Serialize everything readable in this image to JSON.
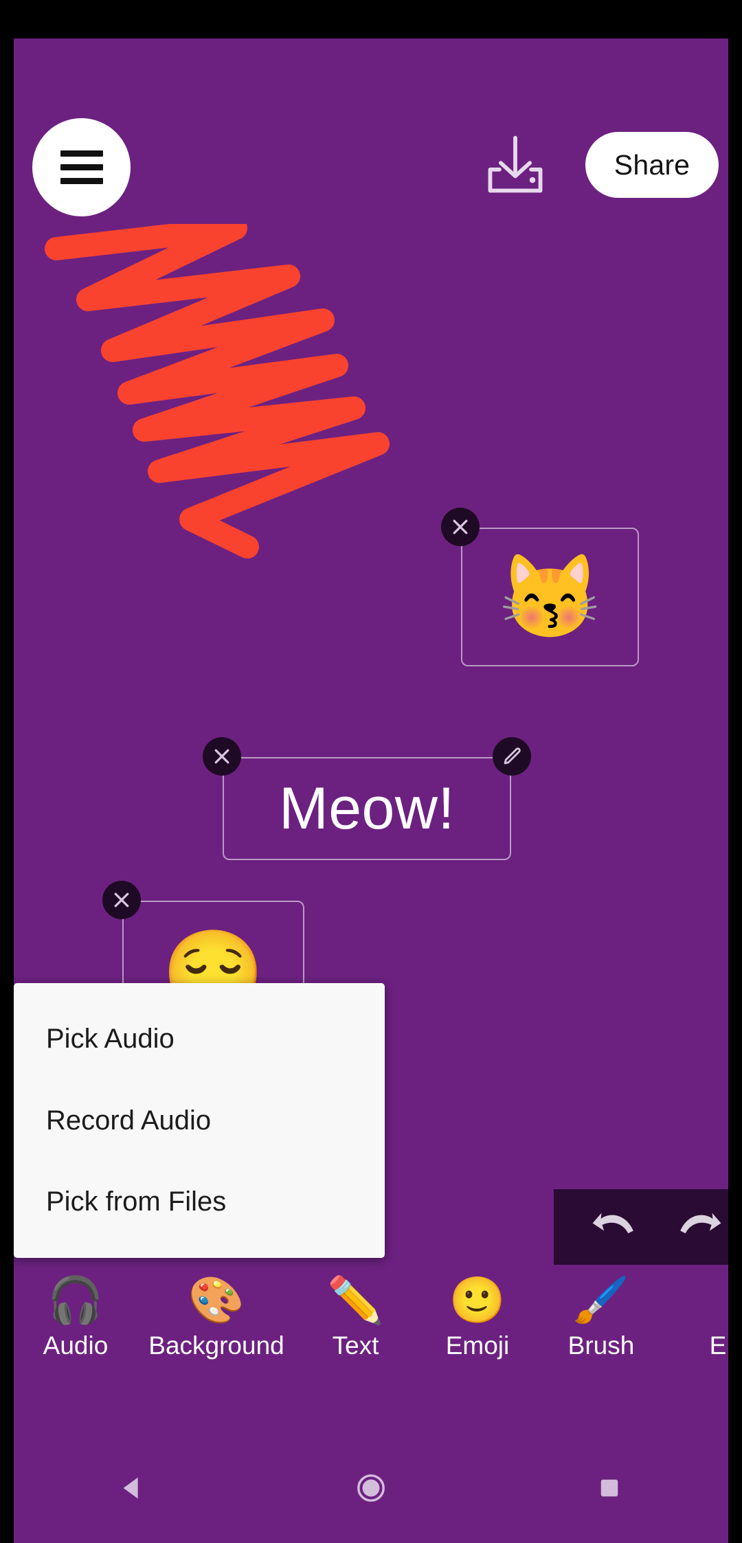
{
  "app": {
    "background_color": "#6C2180",
    "accent_red": "#F9432F"
  },
  "topbar": {
    "menu_icon": "hamburger-menu-icon",
    "save_icon": "save-download-icon",
    "share_label": "Share"
  },
  "canvas": {
    "drawing": {
      "name": "red-zigzag-scribble",
      "stroke_color": "#F9432F"
    },
    "stickers": [
      {
        "type": "emoji",
        "name": "kissing-cat-sticker",
        "glyph": "😽",
        "handles": [
          "delete"
        ]
      },
      {
        "type": "text",
        "name": "meow-text-sticker",
        "value": "Meow!",
        "handles": [
          "delete",
          "edit"
        ]
      },
      {
        "type": "emoji",
        "name": "relieved-face-sticker",
        "glyph": "😌",
        "handles": [
          "delete"
        ]
      }
    ]
  },
  "history": {
    "undo_label": "undo-icon",
    "redo_label": "redo-icon"
  },
  "popup_menu": {
    "items": [
      {
        "label": "Pick Audio"
      },
      {
        "label": "Record Audio"
      },
      {
        "label": "Pick from Files"
      }
    ]
  },
  "toolbar": {
    "items": [
      {
        "label": "Audio",
        "icon": "🎧",
        "icon_name": "headphones-icon"
      },
      {
        "label": "Background",
        "icon": "🎨",
        "icon_name": "palette-icon"
      },
      {
        "label": "Text",
        "icon": "✏️",
        "icon_name": "pencil-icon"
      },
      {
        "label": "Emoji",
        "icon": "🙂",
        "icon_name": "smiley-icon"
      },
      {
        "label": "Brush",
        "icon": "🖌️",
        "icon_name": "paintbrush-icon"
      },
      {
        "label": "E",
        "icon": "",
        "icon_name": "cut-off-item-icon"
      }
    ]
  },
  "navbar": {
    "back_label": "back-nav-button",
    "home_label": "home-nav-button",
    "recents_label": "recents-nav-button"
  }
}
